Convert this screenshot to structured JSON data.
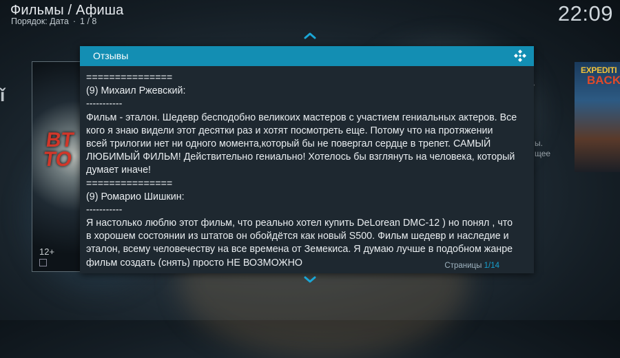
{
  "header": {
    "title": "Фильмы / Афиша",
    "sort_label": "Порядок: Дата",
    "position": "1 / 8",
    "clock": "22:09"
  },
  "posters": {
    "left_title_line1": "BT",
    "left_title_line2": "TO",
    "left_rating": "12+",
    "right_title_line1": "EXPEDITI",
    "right_title_line2": "BACK",
    "right_text_line1": "ы.",
    "right_text_line2": "щее"
  },
  "dialog": {
    "title": "Отзывы",
    "lines": [
      "===============",
      "(9) Михаил Ржевский:",
      "-----------",
      "Фильм - эталон. Шедевр бесподобно великоих мастеров с участием гениальных актеров. Все",
      "кого я знаю видели этот десятки раз и хотят посмотреть еще. Потому что на протяжении",
      "всей трилогии нет ни одного момента,который бы не повергал сердце в трепет. САМЫЙ",
      "ЛЮБИМЫЙ ФИЛЬМ! Действительно гениально! Хотелось бы взглянуть на человека, который",
      "думает иначе!",
      "===============",
      "(9) Ромарио Шишкин:",
      "-----------",
      "Я настолько люблю этот фильм, что реально хотел купить DeLorean DMC-12 )  но понял , что",
      "в хорошем состоянии из штатов он обойдётся как новый S500. Фильм шедевр и наследие и",
      "эталон, всему человечеству на все времена от Земекиса.  Я думаю лучше в подобном жанре",
      "фильм создать (снять) просто НЕ ВОЗМОЖНО"
    ],
    "pages_label": "Страницы",
    "pages_value": "1/14"
  },
  "colors": {
    "accent": "#138eb3",
    "dialog_bg": "#1e2830",
    "page_current": "#16a0cf"
  },
  "icons": {
    "scroll_up": "chevron-up-icon",
    "scroll_down": "chevron-down-icon",
    "brand": "kodi-logo-icon"
  }
}
